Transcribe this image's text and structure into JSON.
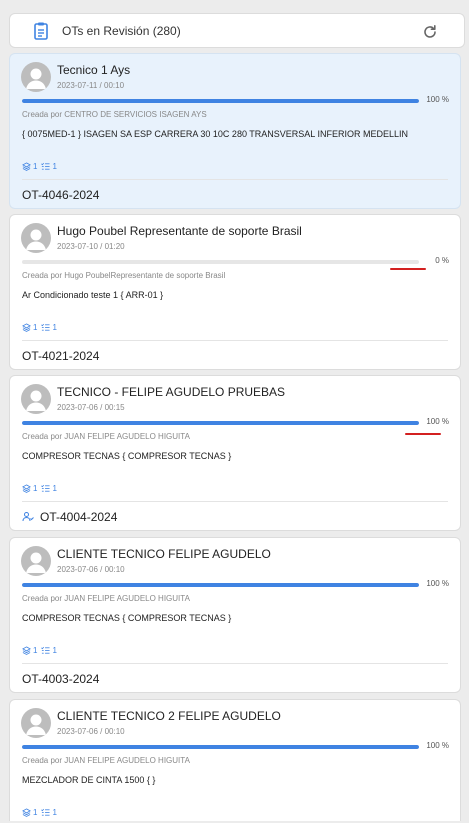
{
  "header": {
    "title": "OTs en Revisión (280)"
  },
  "cards": [
    {
      "name": "Tecnico 1 Ays",
      "date": "2023-07-11 / 00:10",
      "progress_pct": "100 %",
      "progress": 1.0,
      "created_by": "Creada por CENTRO DE SERVICIOS ISAGEN AYS",
      "description": "{ 0075MED-1 } ISAGEN SA ESP CARRERA 30 10C 280 TRANSVERSAL INFERIOR MEDELLIN",
      "count_a": "1",
      "count_b": "1",
      "ot": "OT-4046-2024"
    },
    {
      "name": "Hugo Poubel Representante de soporte Brasil",
      "date": "2023-07-10 / 01:20",
      "progress_pct": "0 %",
      "progress": 0.0,
      "created_by": "Creada por Hugo PoubelRepresentante de soporte Brasil",
      "description": "Ar Condicionado teste 1 { ARR-01 }",
      "count_a": "1",
      "count_b": "1",
      "ot": "OT-4021-2024"
    },
    {
      "name": "TECNICO - FELIPE AGUDELO PRUEBAS",
      "date": "2023-07-06 / 00:15",
      "progress_pct": "100 %",
      "progress": 1.0,
      "created_by": "Creada por JUAN FELIPE AGUDELO HIGUITA",
      "description": "COMPRESOR TECNAS { COMPRESOR TECNAS }",
      "count_a": "1",
      "count_b": "1",
      "ot": "OT-4004-2024"
    },
    {
      "name": "CLIENTE TECNICO FELIPE AGUDELO",
      "date": "2023-07-06 / 00:10",
      "progress_pct": "100 %",
      "progress": 1.0,
      "created_by": "Creada por JUAN FELIPE AGUDELO HIGUITA",
      "description": "COMPRESOR TECNAS { COMPRESOR TECNAS }",
      "count_a": "1",
      "count_b": "1",
      "ot": "OT-4003-2024"
    },
    {
      "name": "CLIENTE TECNICO 2 FELIPE AGUDELO",
      "date": "2023-07-06 / 00:10",
      "progress_pct": "100 %",
      "progress": 1.0,
      "created_by": "Creada por JUAN FELIPE AGUDELO HIGUITA",
      "description": "MEZCLADOR DE CINTA 1500 { }",
      "count_a": "1",
      "count_b": "1",
      "ot": ""
    }
  ],
  "colors": {
    "accent": "#3f83e2",
    "highlight_card": "#e8f2fc",
    "annotation_red": "#d32020"
  },
  "icons": {
    "header": "document-list-icon",
    "refresh": "refresh-icon",
    "avatar": "user-avatar-icon",
    "meta_a": "layers-icon",
    "meta_b": "checklist-icon",
    "ot_assign": "user-group-icon"
  }
}
